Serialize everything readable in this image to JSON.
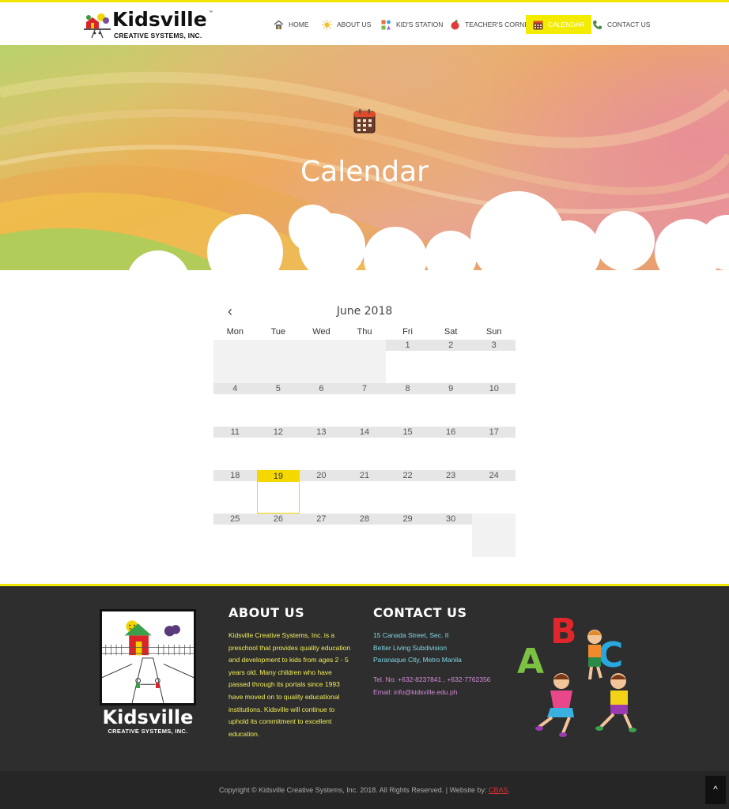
{
  "nav": {
    "brand": "Kidsville",
    "brand_tm": "™",
    "brand_sub": "CREATIVE SYSTEMS, INC.",
    "items": [
      {
        "label": "HOME",
        "icon": "house-icon"
      },
      {
        "label": "ABOUT US",
        "icon": "sun-icon"
      },
      {
        "label": "KID'S STATION",
        "icon": "toys-icon"
      },
      {
        "label": "TEACHER'S CORNER",
        "icon": "apple-icon"
      },
      {
        "label": "CALENDAR",
        "icon": "calendar-icon",
        "active": true
      },
      {
        "label": "CONTACT US",
        "icon": "phone-icon"
      }
    ],
    "accent": "#f4ec00"
  },
  "hero": {
    "title": "Calendar"
  },
  "calendar": {
    "prev_icon": "‹",
    "month": "June 2018",
    "weekdays": [
      "Mon",
      "Tue",
      "Wed",
      "Thu",
      "Fri",
      "Sat",
      "Sun"
    ],
    "weeks": [
      [
        "",
        "",
        "",
        "",
        "1",
        "2",
        "3"
      ],
      [
        "4",
        "5",
        "6",
        "7",
        "8",
        "9",
        "10"
      ],
      [
        "11",
        "12",
        "13",
        "14",
        "15",
        "16",
        "17"
      ],
      [
        "18",
        "19",
        "20",
        "21",
        "22",
        "23",
        "24"
      ],
      [
        "25",
        "26",
        "27",
        "28",
        "29",
        "30",
        ""
      ]
    ],
    "today": "19",
    "today_color": "#f4d800"
  },
  "footer": {
    "brand": "Kidsville",
    "brand_sub": "CREATIVE SYSTEMS, INC.",
    "about_heading": "ABOUT US",
    "about_text": "Kidsville Creative Systems, Inc. is a preschool that provides quality education and development to kids from ages 2 - 5 years old. Many children who have passed through its portals since 1993 have moved on to quality educational institutions. Kidsville will continue to uphold its commitment to excellent education.",
    "contact_heading": "CONTACT US",
    "address": [
      "15 Canada Street, Sec. II",
      "Better Living Subdivision",
      "Paranaque City, Metro Manila"
    ],
    "tel": "Tel. No: +632-8237841 , +632-7762356",
    "email": "Email: info@kidsville.edu.ph",
    "copyright_prefix": "Copyright © Kidsville Creative Systems, Inc. 2018. All Rights Reserved. | Website by: ",
    "copyright_link": "CBAS",
    "copyright_suffix": ".",
    "to_top_icon": "^"
  }
}
